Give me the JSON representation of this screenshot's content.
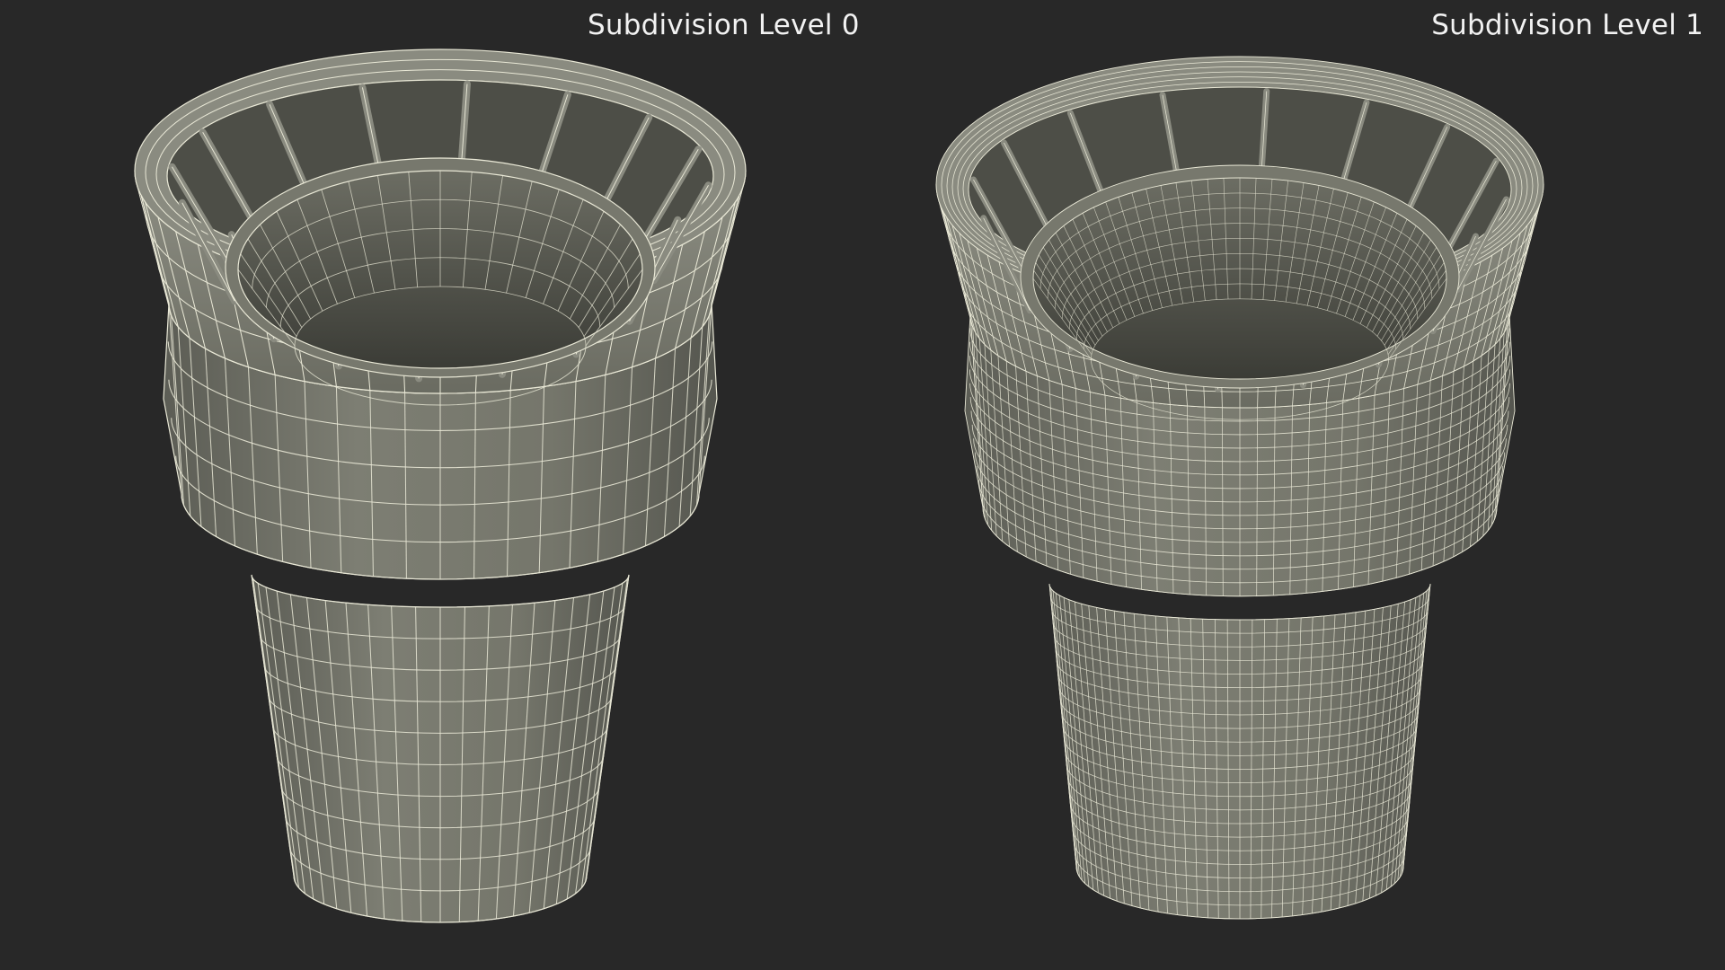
{
  "viewports": [
    {
      "label": "Subdivision Level 0"
    },
    {
      "label": "Subdivision Level 1"
    }
  ],
  "colors": {
    "background": "#282828",
    "surface": "#77786d",
    "surface_light": "#8a8b80",
    "surface_dark": "#4d4e47",
    "inner_dark": "#3f403a",
    "wire": "#e9e8d6"
  }
}
